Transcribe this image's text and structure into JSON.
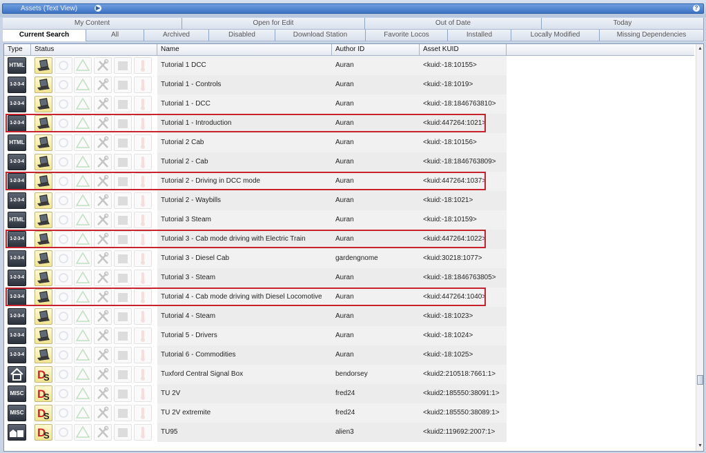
{
  "window": {
    "title": "Assets (Text View)"
  },
  "tabs_row1": [
    "My Content",
    "Open for Edit",
    "Out of Date",
    "Today"
  ],
  "tabs_row2": [
    "Current Search",
    "All",
    "Archived",
    "Disabled",
    "Download Station",
    "Favorite Locos",
    "Installed",
    "Locally Modified",
    "Missing Dependencies"
  ],
  "columns": {
    "type": "Type",
    "status": "Status",
    "name": "Name",
    "author": "Author ID",
    "kuid": "Asset KUID"
  },
  "rows": [
    {
      "type_icon": "HTML",
      "status_icon": "laptop-icon",
      "name": "Tutorial 1 DCC",
      "author": "Auran",
      "kuid": "<kuid:-18:10155>",
      "highlighted": false
    },
    {
      "type_icon": "1-2-3-4",
      "status_icon": "laptop-icon",
      "name": "Tutorial 1 - Controls",
      "author": "Auran",
      "kuid": "<kuid:-18:1019>",
      "highlighted": false
    },
    {
      "type_icon": "1-2-3-4",
      "status_icon": "laptop-icon",
      "name": "Tutorial 1 - DCC",
      "author": "Auran",
      "kuid": "<kuid:-18:1846763810>",
      "highlighted": false
    },
    {
      "type_icon": "1-2-3-4",
      "status_icon": "laptop-icon",
      "name": "Tutorial 1 - Introduction",
      "author": "Auran",
      "kuid": "<kuid:447264:1021>",
      "highlighted": true
    },
    {
      "type_icon": "HTML",
      "status_icon": "laptop-icon",
      "name": "Tutorial 2 Cab",
      "author": "Auran",
      "kuid": "<kuid:-18:10156>",
      "highlighted": false
    },
    {
      "type_icon": "1-2-3-4",
      "status_icon": "laptop-icon",
      "name": "Tutorial 2 - Cab",
      "author": "Auran",
      "kuid": "<kuid:-18:1846763809>",
      "highlighted": false
    },
    {
      "type_icon": "1-2-3-4",
      "status_icon": "laptop-icon",
      "name": "Tutorial 2 - Driving in DCC mode",
      "author": "Auran",
      "kuid": "<kuid:447264:1037>",
      "highlighted": true
    },
    {
      "type_icon": "1-2-3-4",
      "status_icon": "laptop-icon",
      "name": "Tutorial 2 - Waybills",
      "author": "Auran",
      "kuid": "<kuid:-18:1021>",
      "highlighted": false
    },
    {
      "type_icon": "HTML",
      "status_icon": "laptop-icon",
      "name": "Tutorial 3 Steam",
      "author": "Auran",
      "kuid": "<kuid:-18:10159>",
      "highlighted": false
    },
    {
      "type_icon": "1-2-3-4",
      "status_icon": "laptop-icon",
      "name": "Tutorial 3 - Cab mode driving with Electric Train",
      "author": "Auran",
      "kuid": "<kuid:447264:1022>",
      "highlighted": true
    },
    {
      "type_icon": "1-2-3-4",
      "status_icon": "laptop-icon",
      "name": "Tutorial 3 - Diesel Cab",
      "author": "gardengnome",
      "kuid": "<kuid:30218:1077>",
      "highlighted": false
    },
    {
      "type_icon": "1-2-3-4",
      "status_icon": "laptop-icon",
      "name": "Tutorial 3 - Steam",
      "author": "Auran",
      "kuid": "<kuid:-18:1846763805>",
      "highlighted": false
    },
    {
      "type_icon": "1-2-3-4",
      "status_icon": "laptop-icon",
      "name": "Tutorial 4 - Cab mode driving with Diesel Locomotive",
      "author": "Auran",
      "kuid": "<kuid:447264:1040>",
      "highlighted": true
    },
    {
      "type_icon": "1-2-3-4",
      "status_icon": "laptop-icon",
      "name": "Tutorial 4 - Steam",
      "author": "Auran",
      "kuid": "<kuid:-18:1023>",
      "highlighted": false
    },
    {
      "type_icon": "1-2-3-4",
      "status_icon": "laptop-icon",
      "name": "Tutorial 5 - Drivers",
      "author": "Auran",
      "kuid": "<kuid:-18:1024>",
      "highlighted": false
    },
    {
      "type_icon": "1-2-3-4",
      "status_icon": "laptop-icon",
      "name": "Tutorial 6 - Commodities",
      "author": "Auran",
      "kuid": "<kuid:-18:1025>",
      "highlighted": false
    },
    {
      "type_icon": "house-icon",
      "status_icon": "download-station-icon",
      "name": "Tuxford Central Signal Box",
      "author": "bendorsey",
      "kuid": "<kuid2:210518:7661:1>",
      "highlighted": false
    },
    {
      "type_icon": "MISC",
      "status_icon": "download-station-icon",
      "name": "TU 2V",
      "author": "fred24",
      "kuid": "<kuid2:185550:38091:1>",
      "highlighted": false
    },
    {
      "type_icon": "MISC",
      "status_icon": "download-station-icon",
      "name": "TU 2V extremite",
      "author": "fred24",
      "kuid": "<kuid2:185550:38089:1>",
      "highlighted": false
    },
    {
      "type_icon": "buildings-icon",
      "status_icon": "download-station-icon",
      "name": "TU95",
      "author": "alien3",
      "kuid": "<kuid2:119692:2007:1>",
      "highlighted": false
    }
  ]
}
